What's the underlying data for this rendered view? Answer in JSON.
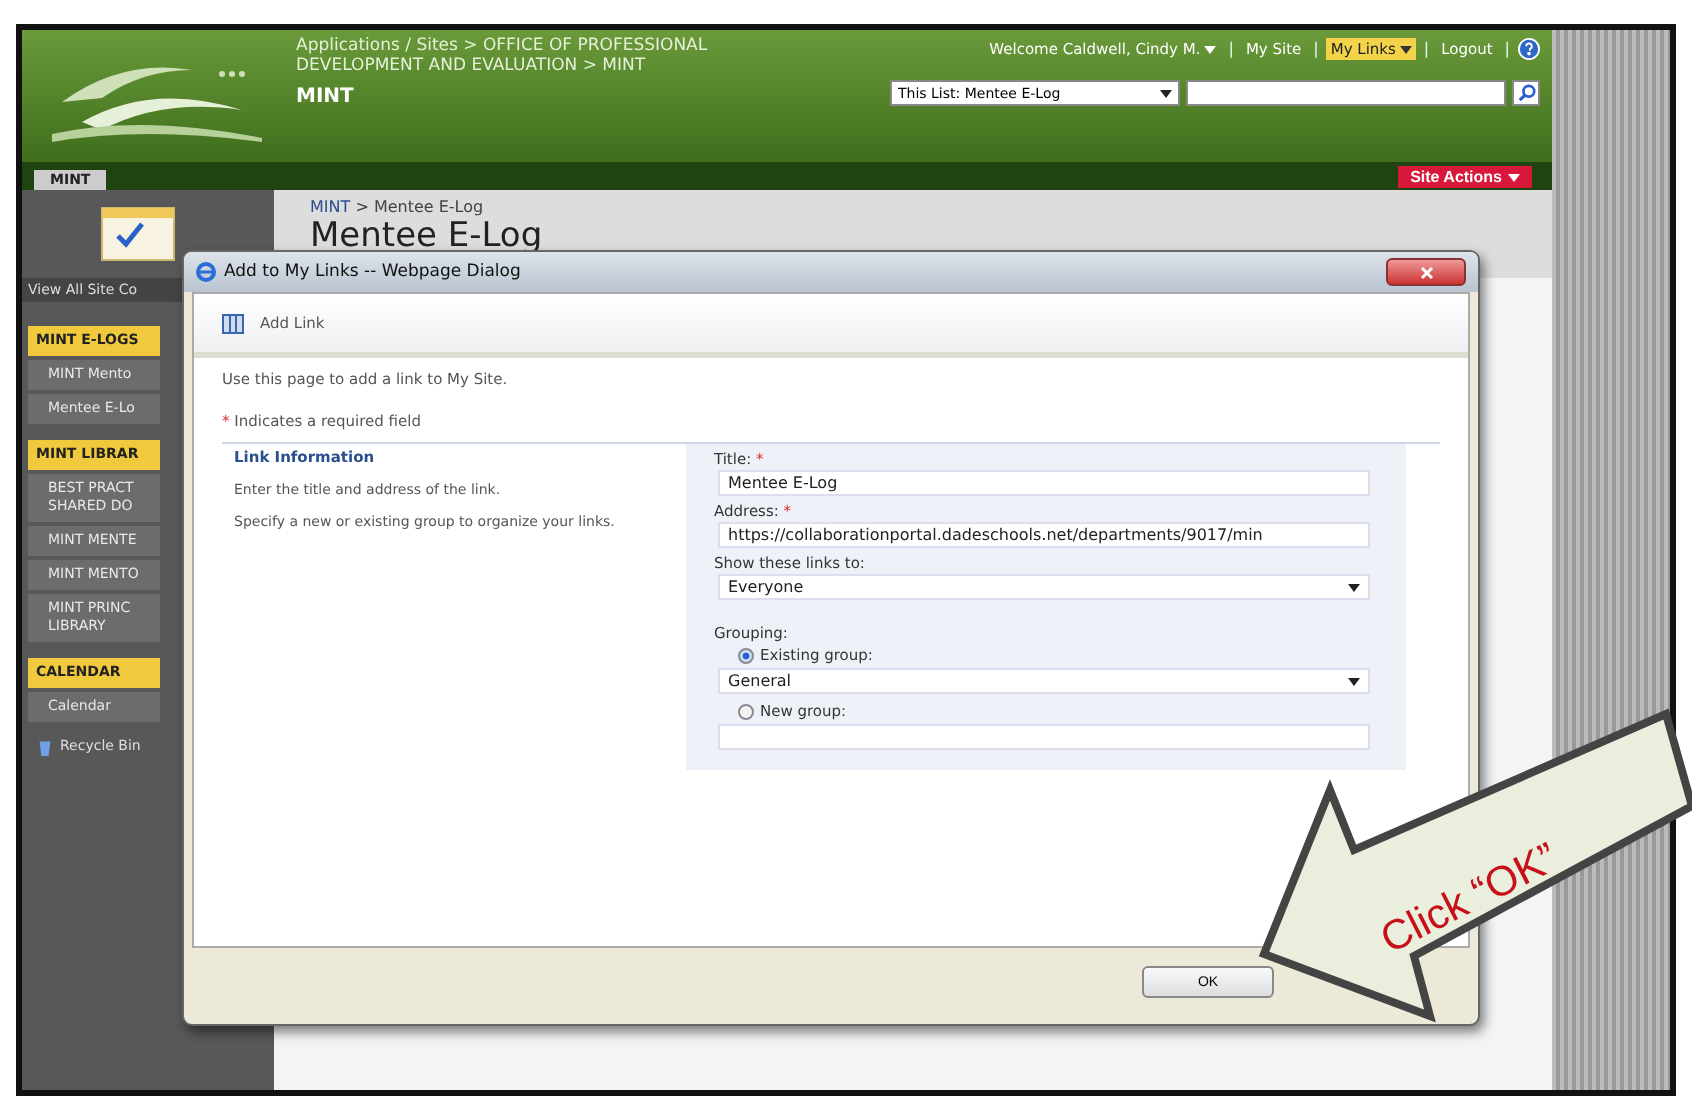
{
  "header": {
    "breadcrumb": "Applications / Sites > OFFICE OF PROFESSIONAL DEVELOPMENT AND EVALUATION > MINT",
    "site_title": "MINT",
    "user_links": [
      {
        "label": "Welcome Caldwell, Cindy M.",
        "kind": "menu",
        "highlighted": false
      },
      {
        "label": "|",
        "kind": "separator"
      },
      {
        "label": "My Site",
        "kind": "link",
        "highlighted": false
      },
      {
        "label": "|",
        "kind": "separator"
      },
      {
        "label": "My Links",
        "kind": "menu",
        "highlighted": true
      },
      {
        "label": "|",
        "kind": "separator"
      },
      {
        "label": "Logout",
        "kind": "link",
        "highlighted": false
      },
      {
        "label": "|",
        "kind": "separator"
      }
    ],
    "search_scope": "This List: Mentee E-Log",
    "tab": "MINT",
    "site_actions": "Site Actions"
  },
  "page": {
    "breadcrumb_root": "MINT",
    "breadcrumb_separator": ">",
    "breadcrumb_current": "Mentee E-Log",
    "title": "Mentee E-Log"
  },
  "sidebar": {
    "view_all": "View All Site Co",
    "items": [
      {
        "kind": "heading",
        "label": "MINT E-LOGS"
      },
      {
        "kind": "link",
        "label": "MINT Mento"
      },
      {
        "kind": "link",
        "label": "Mentee E-Lo"
      },
      {
        "kind": "heading",
        "label": "MINT LIBRAR"
      },
      {
        "kind": "link",
        "label": "BEST PRACT SHARED DO"
      },
      {
        "kind": "link",
        "label": "MINT MENTE"
      },
      {
        "kind": "link",
        "label": "MINT MENTO"
      },
      {
        "kind": "link",
        "label": "MINT PRINC LIBRARY"
      },
      {
        "kind": "heading",
        "label": "CALENDAR"
      },
      {
        "kind": "link",
        "label": "Calendar"
      },
      {
        "kind": "recycle",
        "label": "Recycle Bin"
      }
    ]
  },
  "dialog": {
    "title": "Add to My Links -- Webpage Dialog",
    "toolbar_label": "Add Link",
    "intro": "Use this page to add a link to My Site.",
    "required_mark": "*",
    "required_note": "Indicates a required field",
    "section_title": "Link Information",
    "section_descriptions": [
      "Enter the title and address of the link.",
      "Specify a new or existing group to organize your links."
    ],
    "title_label": "Title:",
    "title_value": "Mentee E-Log",
    "address_label": "Address:",
    "address_value": "https://collaborationportal.dadeschools.net/departments/9017/min",
    "show_label": "Show these links to:",
    "show_value": "Everyone",
    "grouping_label": "Grouping:",
    "group_options": [
      {
        "label": "Existing group:",
        "selected": true
      },
      {
        "label": "New group:",
        "selected": false
      }
    ],
    "group_value": "General",
    "buttons": [
      "OK"
    ]
  },
  "callout": {
    "text": "Click “OK”"
  }
}
